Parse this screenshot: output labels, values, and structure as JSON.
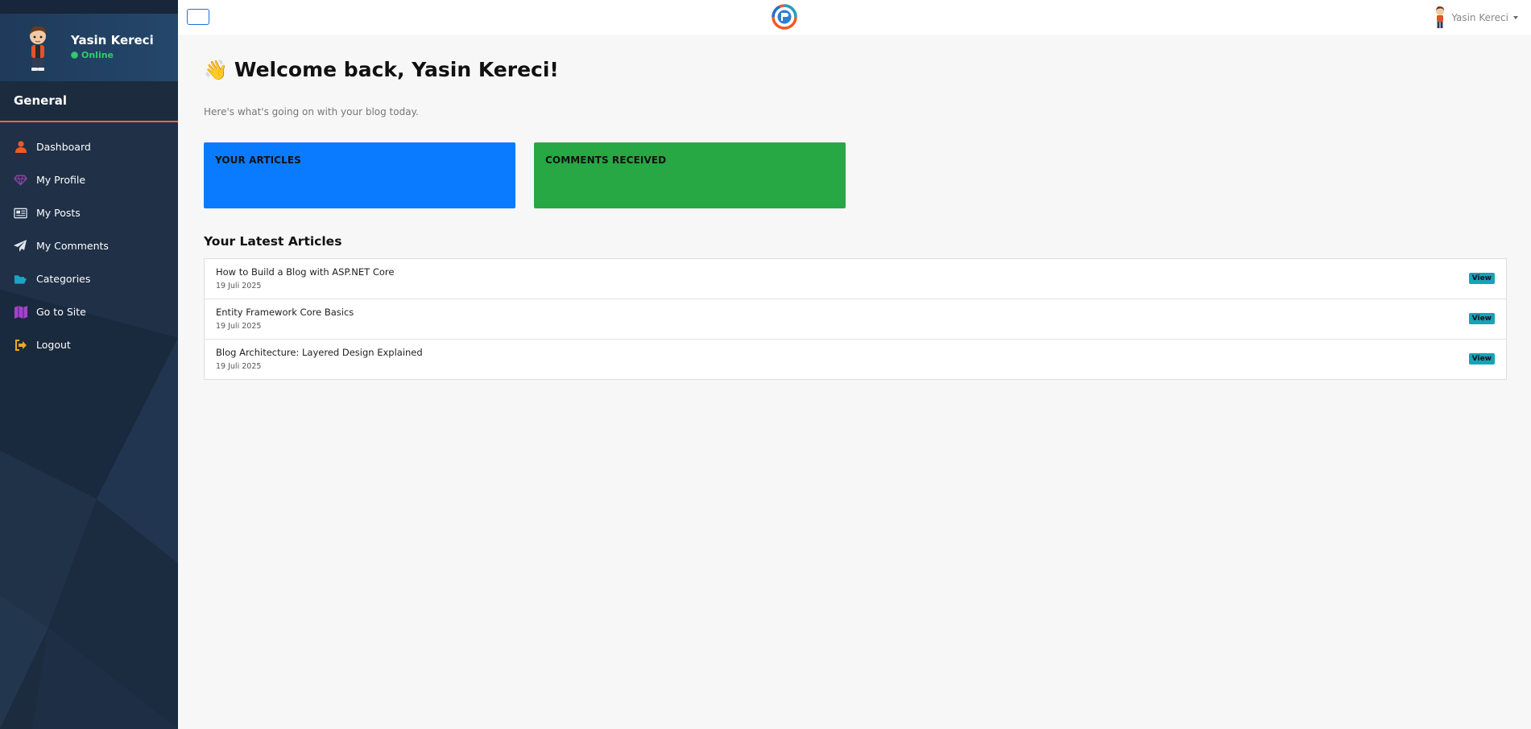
{
  "sidebar": {
    "user": {
      "name": "Yasin Kereci",
      "status": "Online"
    },
    "section_title": "General",
    "items": [
      {
        "label": "Dashboard",
        "icon": "user-icon",
        "color": "#f15a24"
      },
      {
        "label": "My Profile",
        "icon": "gem-icon",
        "color": "#8e44ad"
      },
      {
        "label": "My Posts",
        "icon": "newspaper-icon",
        "color": "#dfe6ee"
      },
      {
        "label": "My Comments",
        "icon": "paper-plane-icon",
        "color": "#dfe6ee"
      },
      {
        "label": "Categories",
        "icon": "folder-open-icon",
        "color": "#1fa3c5"
      },
      {
        "label": "Go to Site",
        "icon": "map-icon",
        "color": "#a83fcf"
      },
      {
        "label": "Logout",
        "icon": "sign-out-icon",
        "color": "#f5a623"
      }
    ]
  },
  "topbar": {
    "user_name": "Yasin Kereci"
  },
  "main": {
    "welcome": "Welcome back, Yasin Kereci!",
    "wave_emoji": "👋",
    "subtitle": "Here's what's going on with your blog today.",
    "stats": [
      {
        "title": "YOUR ARTICLES",
        "value": "",
        "color": "#0a7bff"
      },
      {
        "title": "COMMENTS RECEIVED",
        "value": "",
        "color": "#28a745"
      }
    ],
    "latest_title": "Your Latest Articles",
    "view_label": "View",
    "articles": [
      {
        "title": "How to Build a Blog with ASP.NET Core",
        "date": "19 Juli 2025"
      },
      {
        "title": "Entity Framework Core Basics",
        "date": "19 Juli 2025"
      },
      {
        "title": "Blog Architecture: Layered Design Explained",
        "date": "19 Juli 2025"
      }
    ]
  }
}
